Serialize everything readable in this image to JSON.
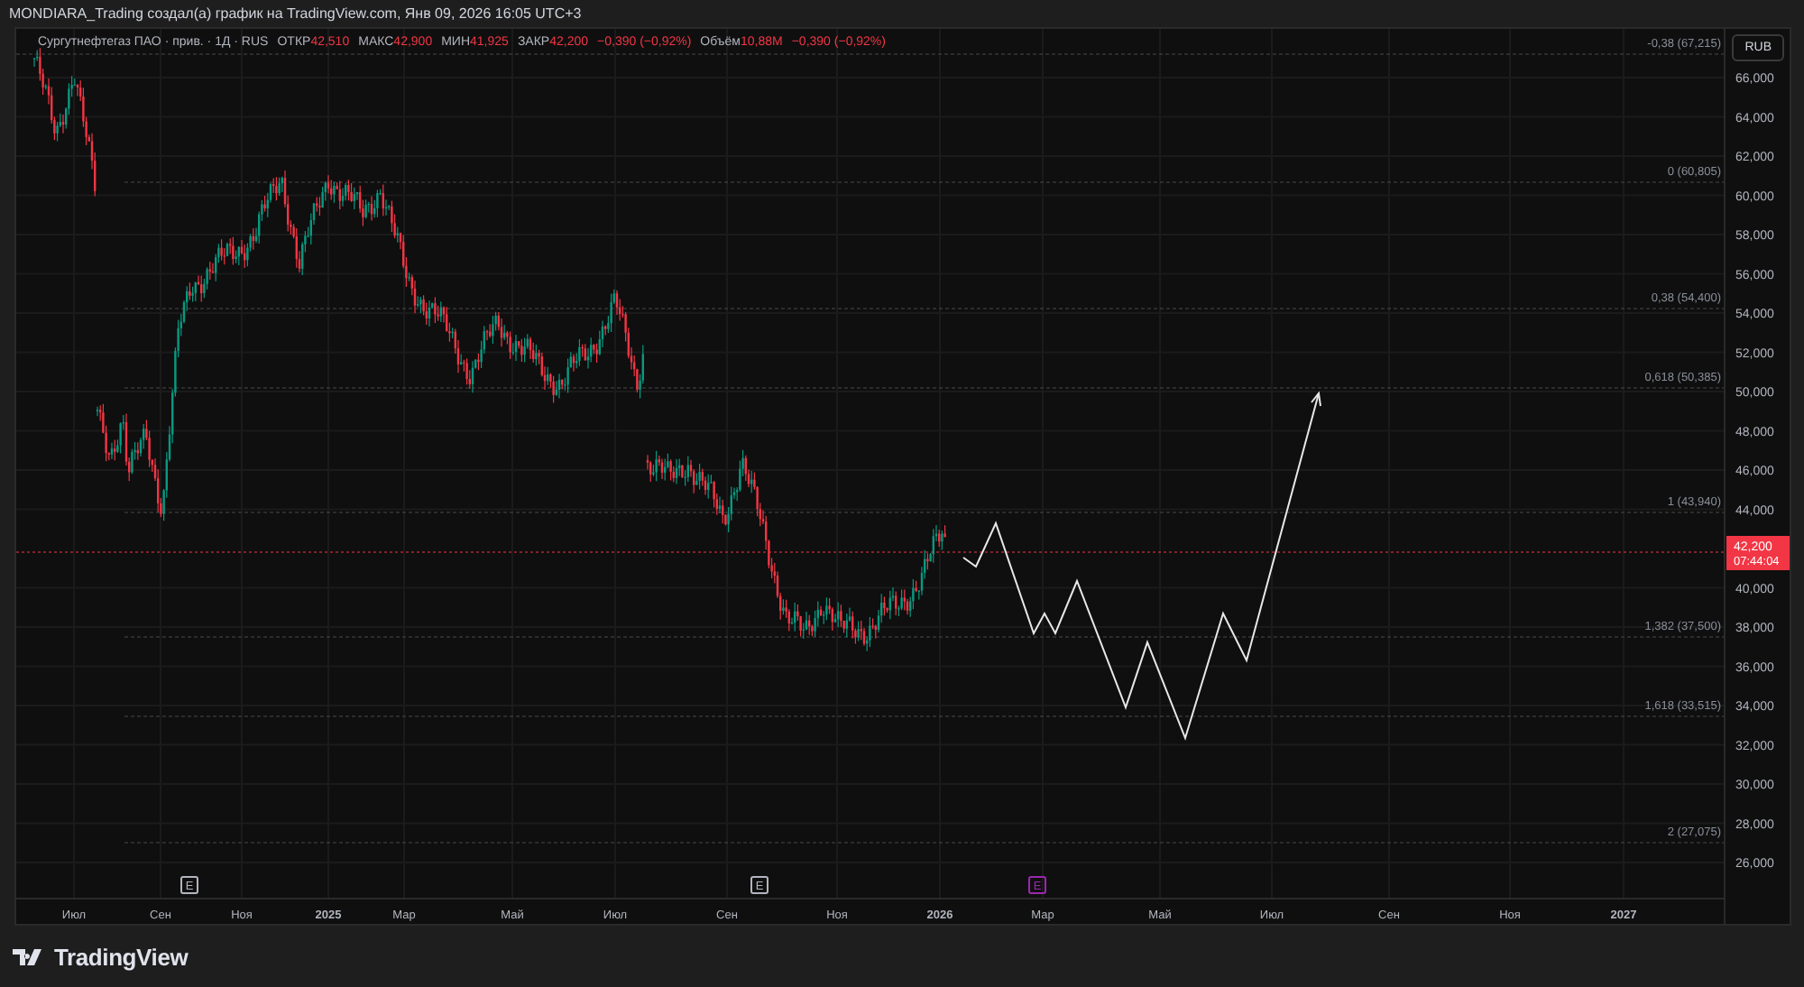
{
  "header": {
    "title": "MONDIARA_Trading создал(а) график на TradingView.com, Янв 09, 2026 16:05 UTC+3"
  },
  "legend": {
    "symbol": "Сургутнефтегаз ПАО · прив. · 1Д · RUS",
    "fields": [
      {
        "label": "ОТКР",
        "value": "42,510"
      },
      {
        "label": "МАКС",
        "value": "42,900"
      },
      {
        "label": "МИН",
        "value": "41,925"
      },
      {
        "label": "ЗАКР",
        "value": "42,200"
      }
    ],
    "change": "−0,390 (−0,92%)",
    "volume": {
      "label": "Объём",
      "value": "10,88M",
      "change": "−0,390 (−0,92%)"
    }
  },
  "currency_button": "RUB",
  "fib_levels": [
    "-0,38 (67,215)",
    "0 (60,805)",
    "0,38 (54,400)",
    "0,618 (50,385)",
    "1 (43,940)",
    "1,382 (37,500)",
    "1,618 (33,515)",
    "2 (27,075)"
  ],
  "price_axis": [
    "66,000",
    "64,000",
    "62,000",
    "60,000",
    "58,000",
    "56,000",
    "54,000",
    "52,000",
    "50,000",
    "48,000",
    "46,000",
    "44,000",
    "40,000",
    "38,000",
    "36,000",
    "34,000",
    "32,000",
    "30,000",
    "28,000",
    "26,000"
  ],
  "current_price": {
    "price": "42,200",
    "countdown": "07:44:04"
  },
  "time_axis": [
    "Июл",
    "Сен",
    "Ноя",
    "2025",
    "Мар",
    "Май",
    "Июл",
    "Сен",
    "Ноя",
    "2026",
    "Мар",
    "Май",
    "Июл",
    "Сен",
    "Ноя",
    "2027"
  ],
  "events": [
    {
      "label": "E",
      "color": "#b2b5be"
    },
    {
      "label": "E",
      "color": "#b2b5be"
    },
    {
      "label": "E",
      "color": "#9c27b0"
    }
  ],
  "footer": {
    "logo": "TradingView"
  }
}
